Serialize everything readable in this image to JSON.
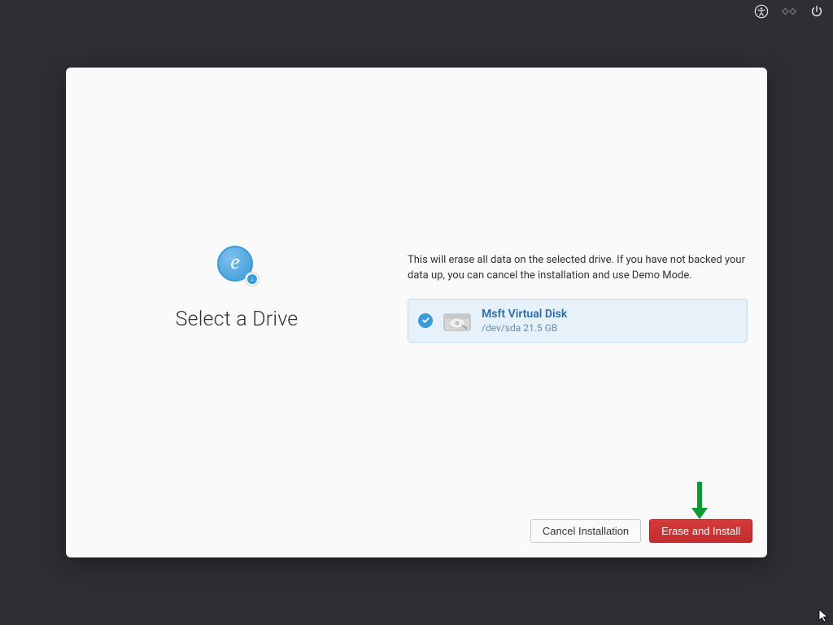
{
  "topbar": {
    "icons": [
      "accessibility-icon",
      "network-disconnected-icon",
      "power-icon"
    ]
  },
  "left": {
    "title": "Select a Drive"
  },
  "right": {
    "warning": "This will erase all data on the selected drive. If you have not backed your data up, you can cancel the installation and use Demo Mode.",
    "drives": [
      {
        "name": "Msft Virtual Disk",
        "path": "/dev/sda 21.5 GB",
        "selected": true
      }
    ]
  },
  "buttons": {
    "cancel": "Cancel Installation",
    "erase": "Erase and Install"
  },
  "colors": {
    "accent": "#3a9bd9",
    "destructive": "#c12e2e",
    "selection_bg": "#e7f1fa"
  }
}
